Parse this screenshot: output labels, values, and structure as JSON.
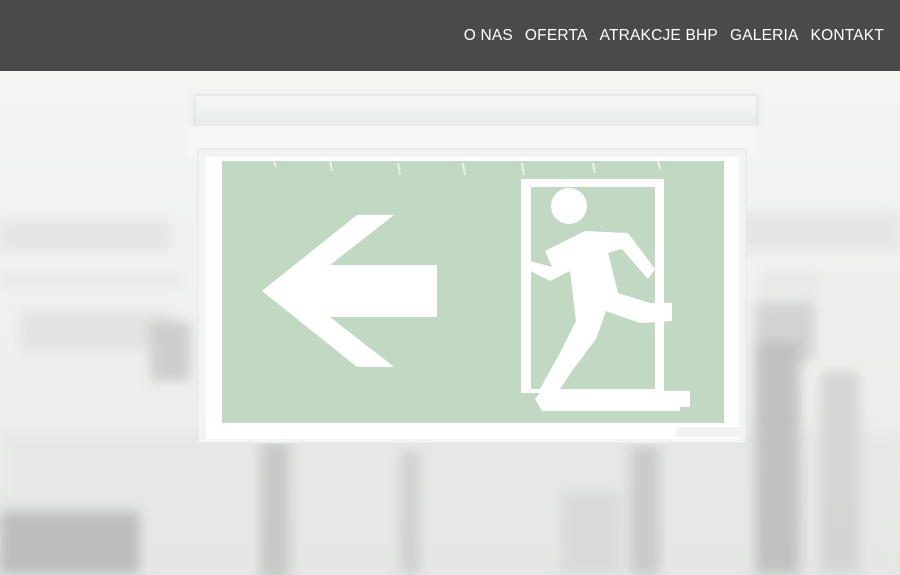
{
  "header": {
    "background_color": "#4a4a4a",
    "nav": [
      {
        "label": "O NAS"
      },
      {
        "label": "OFERTA"
      },
      {
        "label": "ATRAKCJE BHP"
      },
      {
        "label": "GALERIA"
      },
      {
        "label": "KONTAKT"
      }
    ]
  },
  "hero": {
    "image": "emergency-exit-sign-photo",
    "sign_color": "#c1d9c2",
    "sign_icons": [
      "left-arrow-icon",
      "running-person-exit-icon"
    ]
  }
}
